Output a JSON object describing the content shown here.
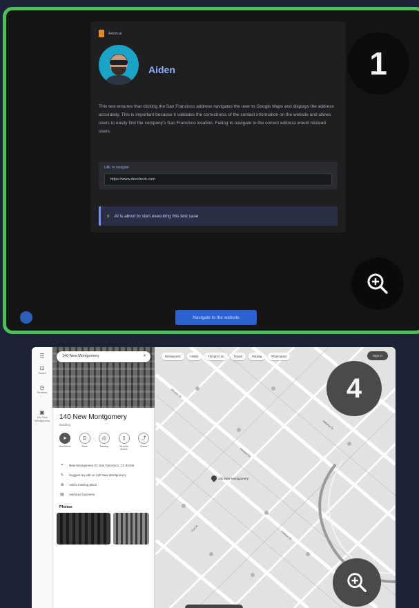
{
  "card1": {
    "brand": "Axiom.ai",
    "username": "Aiden",
    "description": "This test ensures that clicking the San Francisco address navigates the user to Google Maps and displays the address accurately. This is important because it validates the correctness of the contact information on the website and allows users to easily find the company's San Francisco location. Failing to navigate to the correct address would mislead users.",
    "url_label": "URL to navigate",
    "url_value": "https://www.devcheck.com",
    "status_text": "AI is about to start executing this test case",
    "step_number": "1",
    "navigate_button": "Navigate to the website"
  },
  "card2": {
    "step_number": "4",
    "search_value": "140 New Montgomery",
    "rail": [
      "Saved",
      "Recents",
      "140 New Montgomery"
    ],
    "chips": [
      "Restaurants",
      "Hotels",
      "Things to do",
      "Transit",
      "Parking",
      "Pharmacies"
    ],
    "signin": "Sign in",
    "place_title": "140 New Montgomery",
    "place_sub": "Building",
    "actions": [
      "Directions",
      "Save",
      "Nearby",
      "Send to phone",
      "Share"
    ],
    "info": [
      "New Montgomery St, San Francisco, CA 94105",
      "Suggest an edit on 140 New Montgomery",
      "Add a missing place",
      "Add your business"
    ],
    "photos_label": "Photos",
    "pin_label": "140 New Montgomery",
    "streets": [
      "Mission St",
      "Howard St",
      "2nd St",
      "Folsom St",
      "Natoma St"
    ]
  },
  "colors": {
    "highlight_border": "#4fbf5a",
    "primary_button": "#2c62d0",
    "page_bg": "#1d2236"
  }
}
